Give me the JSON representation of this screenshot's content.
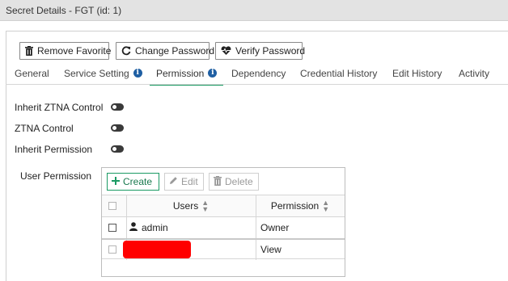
{
  "window": {
    "title": "Secret Details - FGT (id: 1)"
  },
  "toolbar": {
    "remove_favorite": "Remove Favorite",
    "change_password": "Change Password",
    "verify_password": "Verify Password"
  },
  "tabs": [
    {
      "label": "General",
      "info": false
    },
    {
      "label": "Service Setting",
      "info": true
    },
    {
      "label": "Permission",
      "info": true,
      "active": true
    },
    {
      "label": "Dependency",
      "info": false
    },
    {
      "label": "Credential History",
      "info": false
    },
    {
      "label": "Edit History",
      "info": false
    },
    {
      "label": "Activity",
      "info": false
    }
  ],
  "fields": {
    "inherit_ztna": {
      "label": "Inherit ZTNA Control",
      "enabled": false
    },
    "ztna": {
      "label": "ZTNA Control",
      "enabled": false
    },
    "inherit_permission": {
      "label": "Inherit Permission",
      "enabled": false
    },
    "user_permission_label": "User Permission"
  },
  "permission_table": {
    "create": "Create",
    "edit": "Edit",
    "delete": "Delete",
    "columns": [
      "Users",
      "Permission"
    ],
    "rows": [
      {
        "user": "admin",
        "permission": "Owner",
        "redacted": false
      },
      {
        "user": "",
        "permission": "View",
        "redacted": true
      }
    ]
  },
  "colors": {
    "accent": "#1a9a63",
    "info": "#1f5fa3",
    "redaction": "#ff0000"
  }
}
